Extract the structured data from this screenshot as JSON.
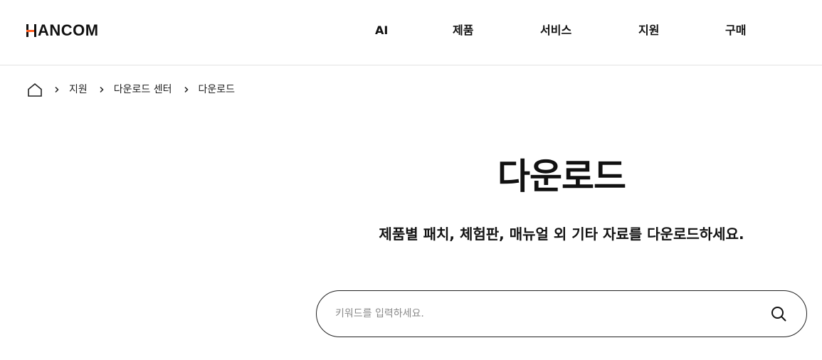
{
  "header": {
    "logo_text": "ANCOM",
    "logo_full": "HANCOM",
    "brand_accent": "#ff5c1f",
    "nav": [
      {
        "label": "AI"
      },
      {
        "label": "제품"
      },
      {
        "label": "서비스"
      },
      {
        "label": "지원"
      },
      {
        "label": "구매"
      }
    ]
  },
  "breadcrumb": {
    "home_icon": "home-icon",
    "separator_icon": "chevron-right-icon",
    "items": [
      {
        "label": "지원"
      },
      {
        "label": "다운로드 센터"
      },
      {
        "label": "다운로드"
      }
    ]
  },
  "main": {
    "title": "다운로드",
    "description": "제품별 패치, 체험판, 매뉴얼 외 기타 자료를 다운로드하세요."
  },
  "search": {
    "placeholder": "키워드를 입력하세요.",
    "value": "",
    "icon": "search-icon"
  }
}
